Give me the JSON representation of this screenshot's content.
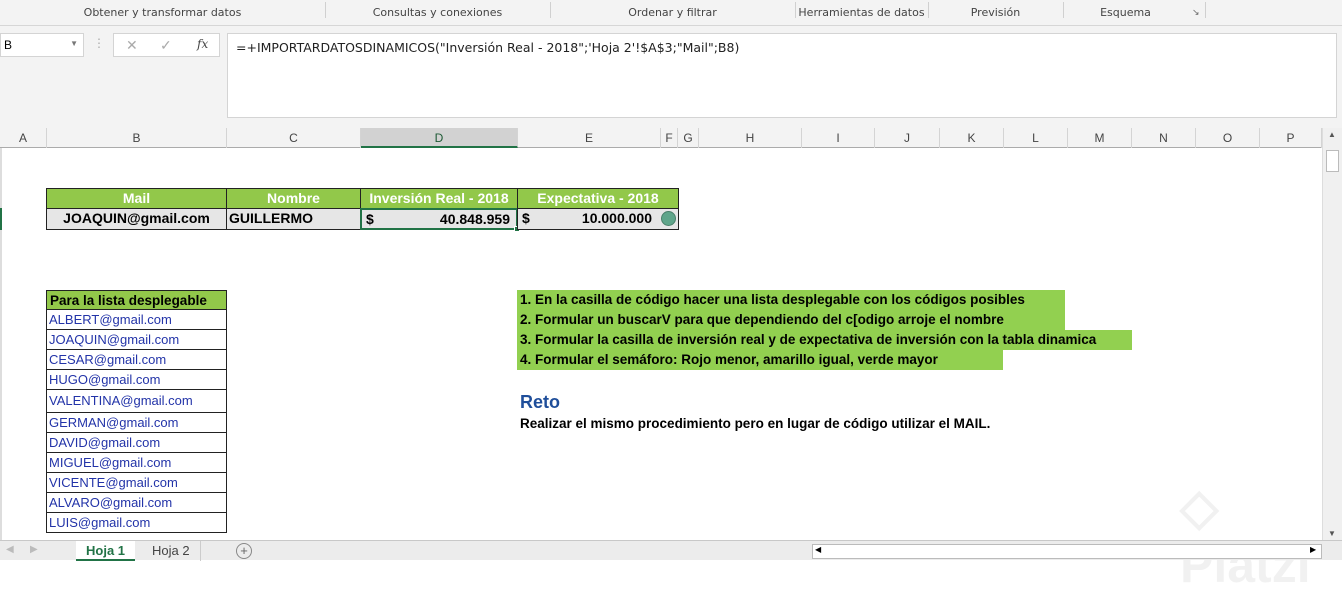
{
  "ribbon": {
    "groups": [
      "Obtener y transformar datos",
      "Consultas y conexiones",
      "Ordenar y filtrar",
      "Herramientas de datos",
      "Previsión",
      "Esquema"
    ]
  },
  "formula_bar": {
    "name_box": "B",
    "cancel": "✕",
    "enter": "✓",
    "fx": "fx",
    "formula": "=+IMPORTARDATOSDINAMICOS(\"Inversión Real - 2018\";'Hoja 2'!$A$3;\"Mail\";B8)"
  },
  "columns": [
    "A",
    "B",
    "C",
    "D",
    "E",
    "F",
    "G",
    "H",
    "I",
    "J",
    "K",
    "L",
    "M",
    "N",
    "O",
    "P"
  ],
  "summary_table": {
    "headers": [
      "Mail",
      "Nombre",
      "Inversión Real - 2018",
      "Expectativa - 2018"
    ],
    "row": {
      "mail": "JOAQUIN@gmail.com",
      "nombre": "GUILLERMO",
      "currency": "$",
      "inversion": "40.848.959",
      "expectativa": "10.000.000"
    },
    "semaforo_color": "#5fa58a"
  },
  "dropdown_list": {
    "title": "Para la lista desplegable",
    "items": [
      "ALBERT@gmail.com",
      "JOAQUIN@gmail.com",
      "CESAR@gmail.com",
      "HUGO@gmail.com",
      "VALENTINA@gmail.com",
      "GERMAN@gmail.com",
      "DAVID@gmail.com",
      "MIGUEL@gmail.com",
      "VICENTE@gmail.com",
      "ALVARO@gmail.com",
      "LUIS@gmail.com"
    ]
  },
  "instructions": [
    "1. En la casilla de código hacer una lista desplegable con los códigos posibles",
    "2. Formular un buscarV para que dependiendo del c[odigo arroje el nombre",
    "3. Formular la casilla de inversión real y de expectativa de inversión con la tabla dinamica",
    "4. Formular el semáforo: Rojo menor, amarillo igual, verde mayor"
  ],
  "reto": {
    "title": "Reto",
    "text": "Realizar el mismo procedimiento pero en lugar de código utilizar el MAIL."
  },
  "sheets": {
    "tabs": [
      "Hoja 1",
      "Hoja 2"
    ],
    "active": "Hoja 1",
    "add": "+"
  },
  "watermark": "Platzi"
}
